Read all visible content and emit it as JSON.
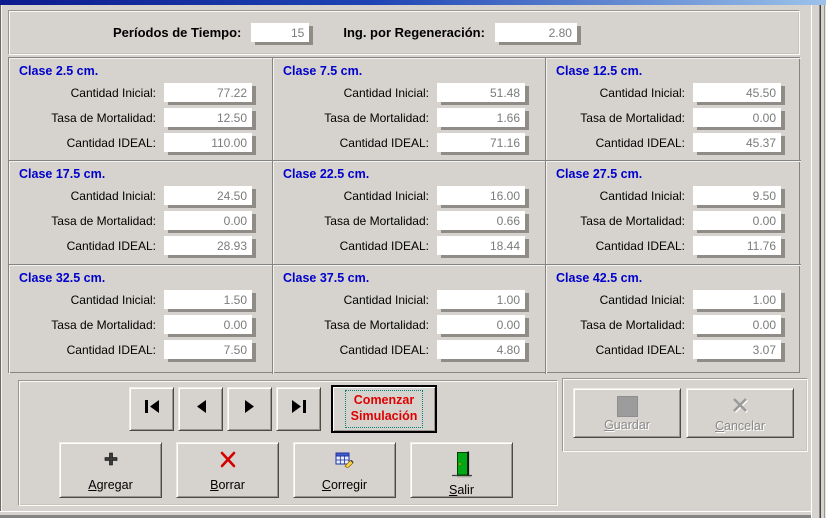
{
  "header": {
    "periods_label": "Períodos de Tiempo:",
    "periods_value": "15",
    "regen_label": "Ing. por Regeneración:",
    "regen_value": "2.80"
  },
  "field_labels": {
    "initial": "Cantidad Inicial:",
    "mortality": "Tasa de Mortalidad:",
    "ideal": "Cantidad IDEAL:"
  },
  "classes": [
    {
      "title": "Clase 2.5 cm.",
      "initial": "77.22",
      "mortality": "12.50",
      "ideal": "110.00"
    },
    {
      "title": "Clase 7.5 cm.",
      "initial": "51.48",
      "mortality": "1.66",
      "ideal": "71.16"
    },
    {
      "title": "Clase 12.5 cm.",
      "initial": "45.50",
      "mortality": "0.00",
      "ideal": "45.37"
    },
    {
      "title": "Clase 17.5 cm.",
      "initial": "24.50",
      "mortality": "0.00",
      "ideal": "28.93"
    },
    {
      "title": "Clase 22.5 cm.",
      "initial": "16.00",
      "mortality": "0.66",
      "ideal": "18.44"
    },
    {
      "title": "Clase 27.5 cm.",
      "initial": "9.50",
      "mortality": "0.00",
      "ideal": "11.76"
    },
    {
      "title": "Clase 32.5 cm.",
      "initial": "1.50",
      "mortality": "0.00",
      "ideal": "7.50"
    },
    {
      "title": "Clase 37.5 cm.",
      "initial": "1.00",
      "mortality": "0.00",
      "ideal": "4.80"
    },
    {
      "title": "Clase 42.5 cm.",
      "initial": "1.00",
      "mortality": "0.00",
      "ideal": "3.07"
    }
  ],
  "controls": {
    "start_simulation": {
      "line1": "Comenzar",
      "line2": "Simulación"
    },
    "nav_buttons": [
      {
        "name": "first-record"
      },
      {
        "name": "previous-record"
      },
      {
        "name": "next-record"
      },
      {
        "name": "last-record"
      }
    ],
    "actions": [
      {
        "label": "Agregar",
        "icon": "plus-icon"
      },
      {
        "label": "Borrar",
        "icon": "red-x-icon"
      },
      {
        "label": "Corregir",
        "icon": "edit-form-icon"
      },
      {
        "label": "Salir",
        "icon": "exit-door-icon"
      }
    ],
    "save_label": "Guardar",
    "cancel_label": "Cancelar"
  },
  "colors": {
    "window_bg": "#d6d3ce",
    "class_title_blue": "#0000cc",
    "start_button_text_red": "#e00000",
    "field_value_grey": "#7b7b7b",
    "delete_x_red": "#d40000",
    "exit_door_green": "#00a818",
    "titlebar_blue": "#1e45b4"
  }
}
